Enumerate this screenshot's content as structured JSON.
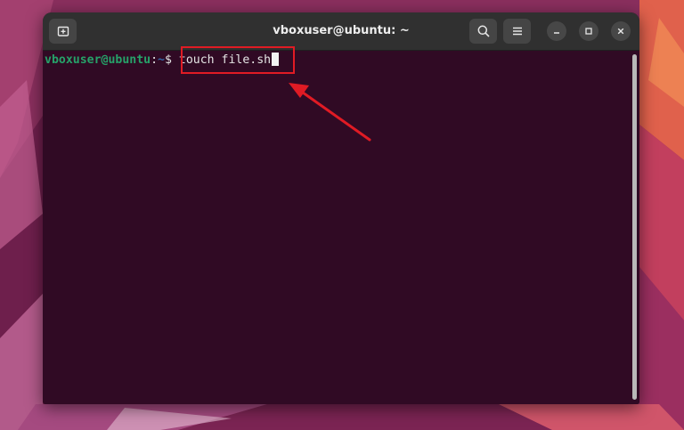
{
  "window": {
    "title": "vboxuser@ubuntu: ~"
  },
  "titlebar": {
    "icons": [
      "new-tab-icon",
      "search-icon",
      "hamburger-menu-icon",
      "minimize-icon",
      "maximize-icon",
      "close-icon"
    ]
  },
  "terminal": {
    "prompt_user": "vboxuser@ubuntu",
    "prompt_sep": ":",
    "prompt_path": "~",
    "prompt_symbol": "$ ",
    "command": "touch file.sh"
  },
  "colors": {
    "terminal_bg": "#300a24",
    "prompt_user": "#26a269",
    "prompt_path": "#3465a4",
    "annotation": "#e01b24",
    "desktop": "#8a2f5e"
  }
}
